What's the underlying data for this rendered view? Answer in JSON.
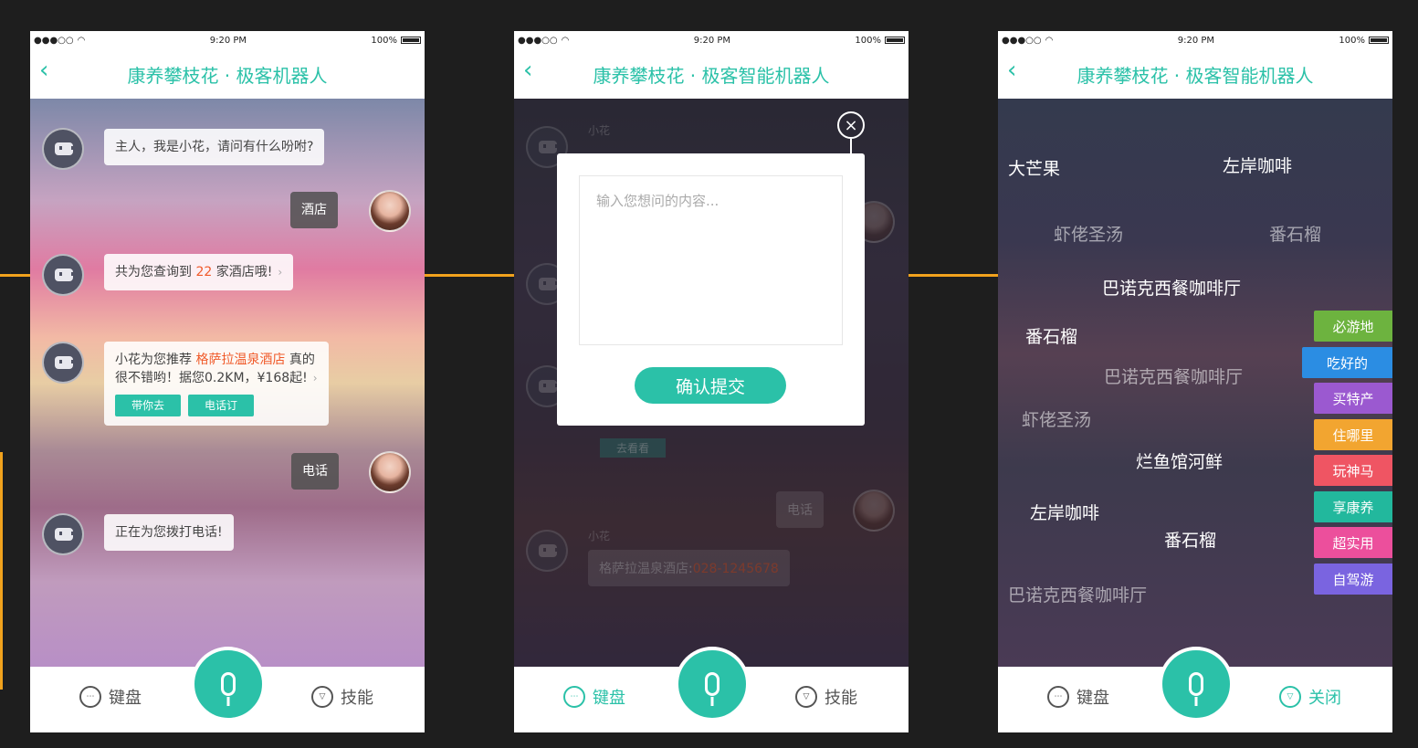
{
  "status": {
    "time": "9:20 PM",
    "battery": "100%"
  },
  "screen1": {
    "title": "康养攀枝花 · 极客机器人",
    "msgs": {
      "bot1": "主人，我是小花，请问有什么吩咐?",
      "user1": "酒店",
      "bot2_pre": "共为您查询到 ",
      "bot2_num": "22",
      "bot2_post": " 家酒店哦!",
      "bot3_pre": "小花为您推荐 ",
      "bot3_hotel": "格萨拉温泉酒店",
      "bot3_post": " 真的",
      "bot3_line2": "很不错哟！据您0.2KM，¥168起!",
      "btn_go": "带你去",
      "btn_call": "电话订",
      "user2": "电话",
      "bot4": "正在为您拨打电话!"
    }
  },
  "screen2": {
    "title": "康养攀枝花 · 极客智能机器人",
    "placeholder": "输入您想问的内容...",
    "confirm": "确认提交",
    "bg_name1": "小花",
    "bg_name2": "小花",
    "bg_btn": "去看看",
    "bg_user": "电话",
    "bg_bot_pre": "格萨拉温泉酒店:",
    "bg_bot_phone": "028-1245678"
  },
  "screen3": {
    "title": "康养攀枝花 · 极客智能机器人",
    "tags": [
      "大芒果",
      "左岸咖啡",
      "虾佬圣汤",
      "番石榴",
      "巴诺克西餐咖啡厅",
      "番石榴",
      "巴诺克西餐咖啡厅",
      "虾佬圣汤",
      "烂鱼馆河鲜",
      "左岸咖啡",
      "番石榴",
      "巴诺克西餐咖啡厅"
    ],
    "categories": [
      {
        "label": "必游地",
        "color": "#6db33f"
      },
      {
        "label": "吃好的",
        "color": "#2b8de3"
      },
      {
        "label": "买特产",
        "color": "#9b59d0"
      },
      {
        "label": "住哪里",
        "color": "#f2a530"
      },
      {
        "label": "玩神马",
        "color": "#ef5563"
      },
      {
        "label": "享康养",
        "color": "#22b89d"
      },
      {
        "label": "超实用",
        "color": "#ec4f9c"
      },
      {
        "label": "自驾游",
        "color": "#7a64e0"
      }
    ]
  },
  "bottombar": {
    "keyboard": "键盘",
    "skills": "技能",
    "close": "关闭"
  }
}
